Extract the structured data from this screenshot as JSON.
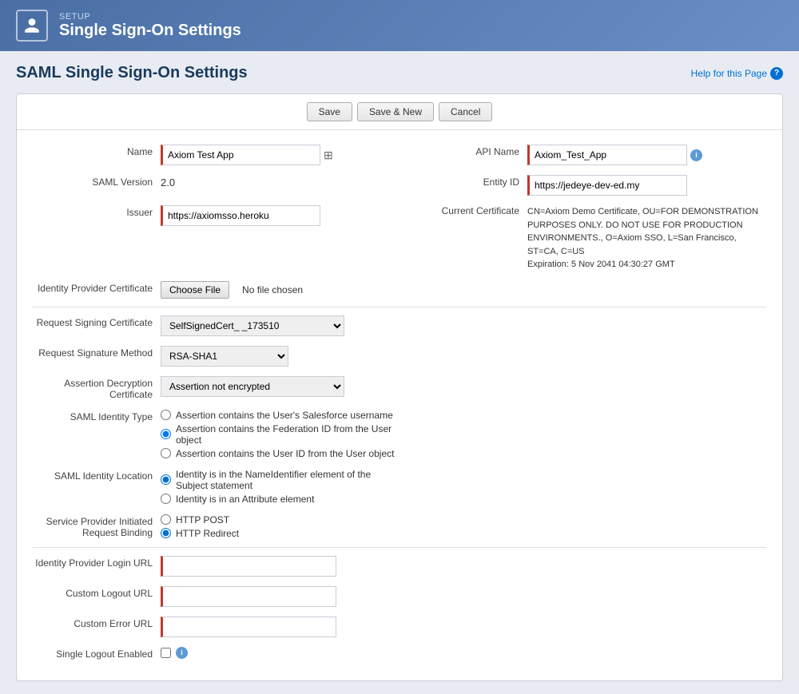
{
  "header": {
    "setup_label": "SETUP",
    "page_title": "Single Sign-On Settings",
    "icon_char": "👤"
  },
  "page": {
    "heading": "SAML Single Sign-On Settings",
    "help_text": "Help for this Page"
  },
  "toolbar": {
    "save_label": "Save",
    "save_new_label": "Save & New",
    "cancel_label": "Cancel"
  },
  "form": {
    "name_label": "Name",
    "name_value": "Axiom Test App",
    "api_name_label": "API Name",
    "api_name_value": "Axiom_Test_App",
    "saml_version_label": "SAML Version",
    "saml_version_value": "2.0",
    "issuer_label": "Issuer",
    "issuer_value": "https://axiomsso.heroku",
    "entity_id_label": "Entity ID",
    "entity_id_value": "https://jedeye-dev-ed.my",
    "idp_cert_label": "Identity Provider Certificate",
    "choose_file_label": "Choose File",
    "no_file_text": "No file chosen",
    "current_cert_label": "Current Certificate",
    "current_cert_value": "CN=Axiom Demo Certificate, OU=FOR DEMONSTRATION PURPOSES ONLY. DO NOT USE FOR PRODUCTION ENVIRONMENTS., O=Axiom SSO, L=San Francisco, ST=CA, C=US\nExpiration: 5 Nov 2041 04:30:27 GMT",
    "request_signing_cert_label": "Request Signing Certificate",
    "request_signing_cert_value": "SelfSignedCert_    _173510",
    "request_sig_method_label": "Request Signature Method",
    "request_sig_method_value": "RSA-SHA1",
    "assertion_decryption_label": "Assertion Decryption Certificate",
    "assertion_decryption_value": "Assertion not encrypted",
    "saml_identity_type_label": "SAML Identity Type",
    "radio_salesforce": "Assertion contains the User's Salesforce username",
    "radio_federation": "Assertion contains the Federation ID from the User object",
    "radio_userid": "Assertion contains the User ID from the User object",
    "saml_identity_location_label": "SAML Identity Location",
    "radio_nameid": "Identity is in the NameIdentifier element of the Subject statement",
    "radio_attribute": "Identity is in an Attribute element",
    "sp_request_binding_label": "Service Provider Initiated\nRequest Binding",
    "radio_http_post": "HTTP POST",
    "radio_http_redirect": "HTTP Redirect",
    "idp_login_url_label": "Identity Provider Login URL",
    "custom_logout_url_label": "Custom Logout URL",
    "custom_error_url_label": "Custom Error URL",
    "single_logout_label": "Single Logout Enabled"
  }
}
